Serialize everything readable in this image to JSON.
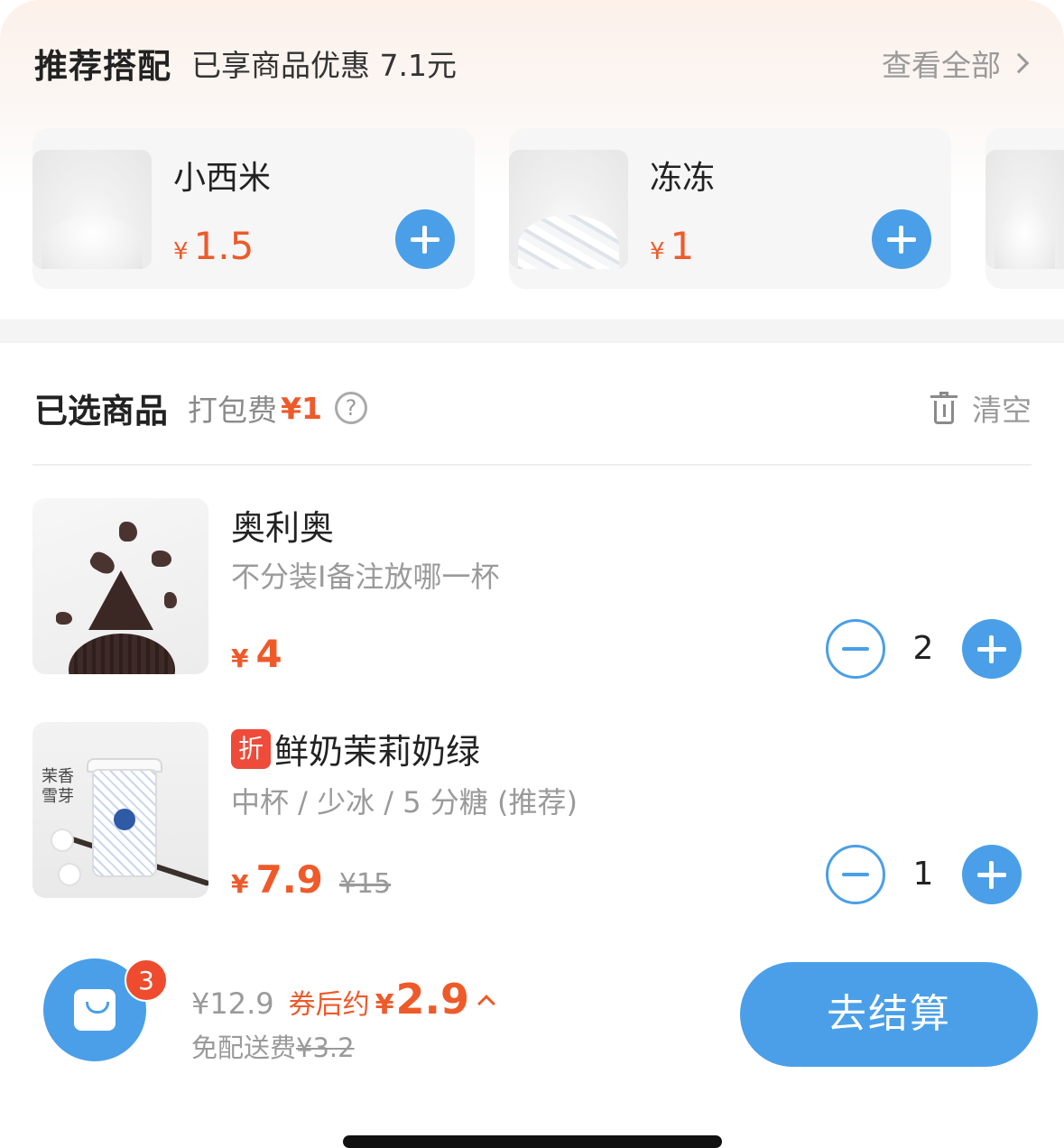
{
  "recommend": {
    "title": "推荐搭配",
    "subtitle": "已享商品优惠 7.1元",
    "view_all": "查看全部",
    "items": [
      {
        "name": "小西米",
        "currency": "¥",
        "price": "1.5"
      },
      {
        "name": "冻冻",
        "currency": "¥",
        "price": "1"
      }
    ]
  },
  "selected": {
    "title": "已选商品",
    "packing_label": "打包费",
    "packing_fee": "¥1",
    "help_icon": "?",
    "clear_label": "清空"
  },
  "cart_items": [
    {
      "name": "奥利奥",
      "spec": "不分装I备注放哪一杯",
      "currency": "¥",
      "price": "4",
      "quantity": "2"
    },
    {
      "tag": "折",
      "name": "鲜奶茉莉奶绿",
      "spec": "中杯 / 少冰 / 5 分糖 (推荐)",
      "currency": "¥",
      "price": "7.9",
      "original_price": "¥15",
      "quantity": "1",
      "image_text": "茉香雪芽"
    }
  ],
  "footer": {
    "cart_count": "3",
    "total_original": "¥12.9",
    "after_coupon_label": "券后约",
    "after_coupon_currency": "¥",
    "after_coupon_price": "2.9",
    "delivery_label": "免配送费",
    "delivery_original": "¥3.2",
    "checkout_label": "去结算"
  },
  "colors": {
    "accent_blue": "#4a9fe8",
    "price_orange": "#ee5a2a",
    "badge_red": "#ee4b2f"
  }
}
